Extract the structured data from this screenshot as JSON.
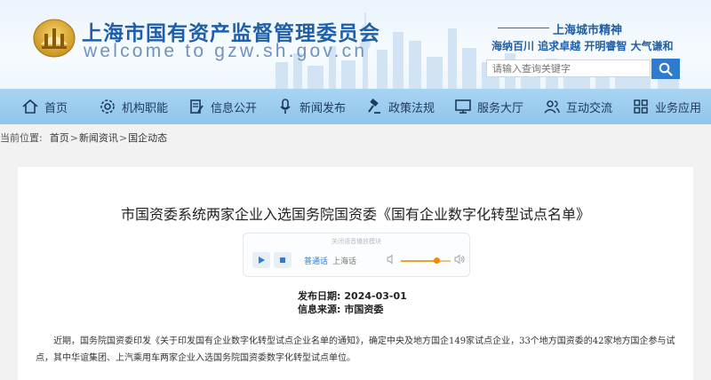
{
  "header": {
    "site_title": "上海市国有资产监督管理委员会",
    "site_domain": "welcome to gzw.sh.gov.cn",
    "spirit_title": "上海城市精神",
    "spirit_slogan": "海纳百川  追求卓越  开明睿智  大气谦和",
    "search": {
      "placeholder": "请输入查询关键字",
      "icon": "search-icon"
    }
  },
  "colors": {
    "brand": "#1f5fa8",
    "nav_bg": "#9ccdf0",
    "search_button": "#2f7bd0",
    "volume": "#f08a00"
  },
  "nav": [
    {
      "label": "首页",
      "icon": "home-icon"
    },
    {
      "label": "机构职能",
      "icon": "gear-icon"
    },
    {
      "label": "信息公开",
      "icon": "document-edit-icon"
    },
    {
      "label": "新闻发布",
      "icon": "microphone-icon"
    },
    {
      "label": "政策法规",
      "icon": "gavel-icon"
    },
    {
      "label": "服务大厅",
      "icon": "monitor-icon"
    },
    {
      "label": "互动交流",
      "icon": "people-icon"
    },
    {
      "label": "业务应用",
      "icon": "apps-grid-icon"
    }
  ],
  "breadcrumb": {
    "label": "当前位置:",
    "items": [
      "首页",
      "新闻资讯",
      "国企动态"
    ],
    "separator": ">"
  },
  "article": {
    "title": "市国资委系统两家企业入选国务院国资委《国有企业数字化转型试点名单》",
    "player": {
      "hint": "关闭语音播放模块",
      "mode_mandarin": "普通话",
      "mode_shanghainese": "上海话",
      "volume": 0.72
    },
    "date_label": "发布日期:",
    "date": "2024-03-01",
    "source_label": "信息来源:",
    "source": "市国资委",
    "body": "近期，国务院国资委印发《关于印发国有企业数字化转型试点企业名单的通知》，确定中央及地方国企149家试点企业，33个地方国资委的42家地方国企参与试点，其中华谊集团、上汽乘用车两家企业入选国务院国资委数字化转型试点单位。"
  }
}
